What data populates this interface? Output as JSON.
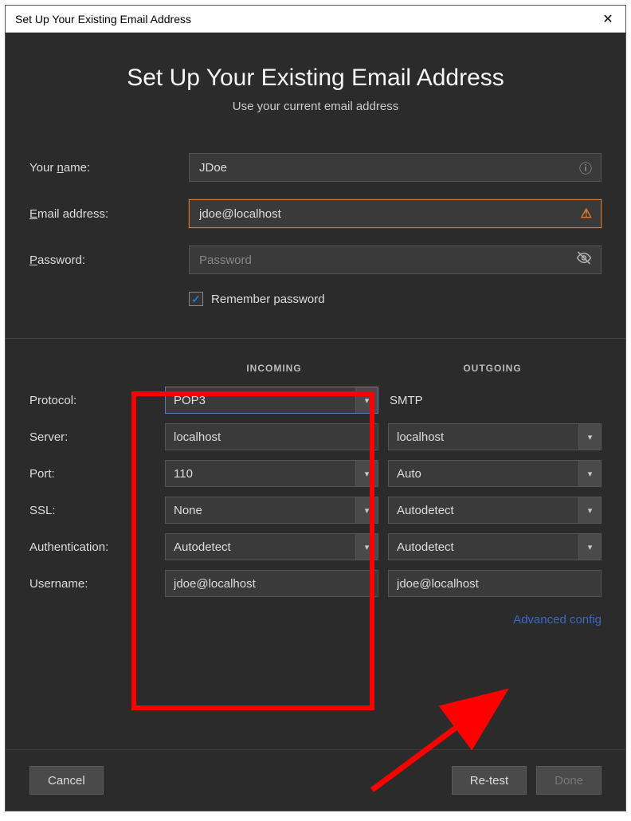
{
  "window": {
    "title": "Set Up Your Existing Email Address"
  },
  "header": {
    "heading": "Set Up Your Existing Email Address",
    "subheading": "Use your current email address"
  },
  "form": {
    "name_label": "Your name:",
    "name_value": "JDoe",
    "email_label": "Email address:",
    "email_value": "jdoe@localhost",
    "password_label": "Password:",
    "password_placeholder": "Password",
    "remember_label": "Remember password",
    "remember_checked": true
  },
  "columns": {
    "incoming": "INCOMING",
    "outgoing": "OUTGOING"
  },
  "rows": {
    "protocol_label": "Protocol:",
    "server_label": "Server:",
    "port_label": "Port:",
    "ssl_label": "SSL:",
    "auth_label": "Authentication:",
    "username_label": "Username:"
  },
  "incoming": {
    "protocol": "POP3",
    "server": "localhost",
    "port": "110",
    "ssl": "None",
    "auth": "Autodetect",
    "username": "jdoe@localhost"
  },
  "outgoing": {
    "protocol": "SMTP",
    "server": "localhost",
    "port": "Auto",
    "ssl": "Autodetect",
    "auth": "Autodetect",
    "username": "jdoe@localhost"
  },
  "link": {
    "advanced": "Advanced config"
  },
  "buttons": {
    "cancel": "Cancel",
    "retest": "Re-test",
    "done": "Done"
  }
}
